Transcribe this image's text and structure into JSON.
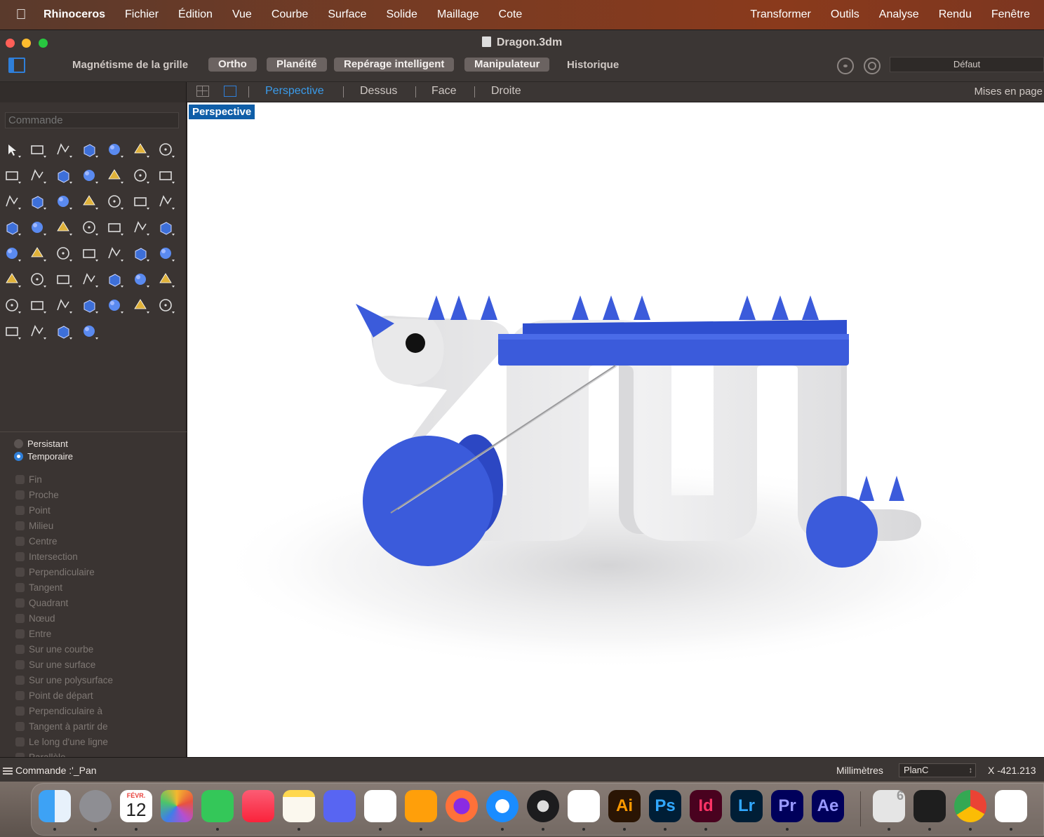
{
  "menubar": {
    "apple_glyph": "",
    "app_name": "Rhinoceros",
    "items": [
      "Fichier",
      "Édition",
      "Vue",
      "Courbe",
      "Surface",
      "Solide",
      "Maillage",
      "Cote"
    ],
    "right_items": [
      "Transformer",
      "Outils",
      "Analyse",
      "Rendu",
      "Fenêtre"
    ]
  },
  "window": {
    "title": "Dragon.3dm",
    "traffic_lights": {
      "close": "#ff5f57",
      "minimize": "#febc2e",
      "zoom": "#28c840"
    }
  },
  "toolbar": {
    "grid_snap": "Magnétisme de la grille",
    "ortho": "Ortho",
    "planar": "Planéité",
    "smart_track": "Repérage intelligent",
    "gumball": "Manipulateur",
    "history": "Historique",
    "layer": "Défaut"
  },
  "viewport_tabs": {
    "tabs": [
      "Perspective",
      "Dessus",
      "Face",
      "Droite"
    ],
    "active": "Perspective",
    "layouts_label": "Mises en page"
  },
  "left_panel": {
    "command_placeholder": "Commande",
    "osnap_modes": [
      "Persistant",
      "Temporaire"
    ],
    "osnap_mode_selected": "Temporaire",
    "osnaps": [
      "Fin",
      "Proche",
      "Point",
      "Milieu",
      "Centre",
      "Intersection",
      "Perpendiculaire",
      "Tangent",
      "Quadrant",
      "Nœud",
      "Entre",
      "Sur une courbe",
      "Sur une surface",
      "Sur une polysurface",
      "Point de départ",
      "Perpendiculaire à",
      "Tangent à partir de",
      "Le long d'une ligne",
      "Parallèle"
    ]
  },
  "viewport": {
    "label": "Perspective",
    "accent": "#3b5bdb",
    "body_color": "#e9e9ea"
  },
  "statusbar": {
    "command": "Commande :'_Pan",
    "units": "Millimètres",
    "cplane": "PlanC",
    "coord": "X  -421.213"
  },
  "dock": {
    "calendar_month": "FÉVR.",
    "calendar_day": "12",
    "apps": [
      {
        "name": "finder",
        "label": ""
      },
      {
        "name": "system-settings",
        "label": ""
      },
      {
        "name": "calendar",
        "label": ""
      },
      {
        "name": "photos",
        "label": ""
      },
      {
        "name": "messages",
        "label": ""
      },
      {
        "name": "music",
        "label": ""
      },
      {
        "name": "notes",
        "label": ""
      },
      {
        "name": "discord",
        "label": ""
      },
      {
        "name": "vscode",
        "label": ""
      },
      {
        "name": "pages",
        "label": ""
      },
      {
        "name": "firefox",
        "label": ""
      },
      {
        "name": "safari",
        "label": ""
      },
      {
        "name": "logic",
        "label": ""
      },
      {
        "name": "acrobat",
        "label": ""
      },
      {
        "name": "illustrator",
        "label": "Ai"
      },
      {
        "name": "photoshop",
        "label": "Ps"
      },
      {
        "name": "indesign",
        "label": "Id"
      },
      {
        "name": "lightroom",
        "label": "Lr"
      },
      {
        "name": "premiere",
        "label": "Pr"
      },
      {
        "name": "after-effects",
        "label": "Ae"
      },
      {
        "name": "rhino",
        "label": "6"
      },
      {
        "name": "figma",
        "label": ""
      },
      {
        "name": "chrome",
        "label": ""
      },
      {
        "name": "app-extra",
        "label": ""
      }
    ]
  }
}
